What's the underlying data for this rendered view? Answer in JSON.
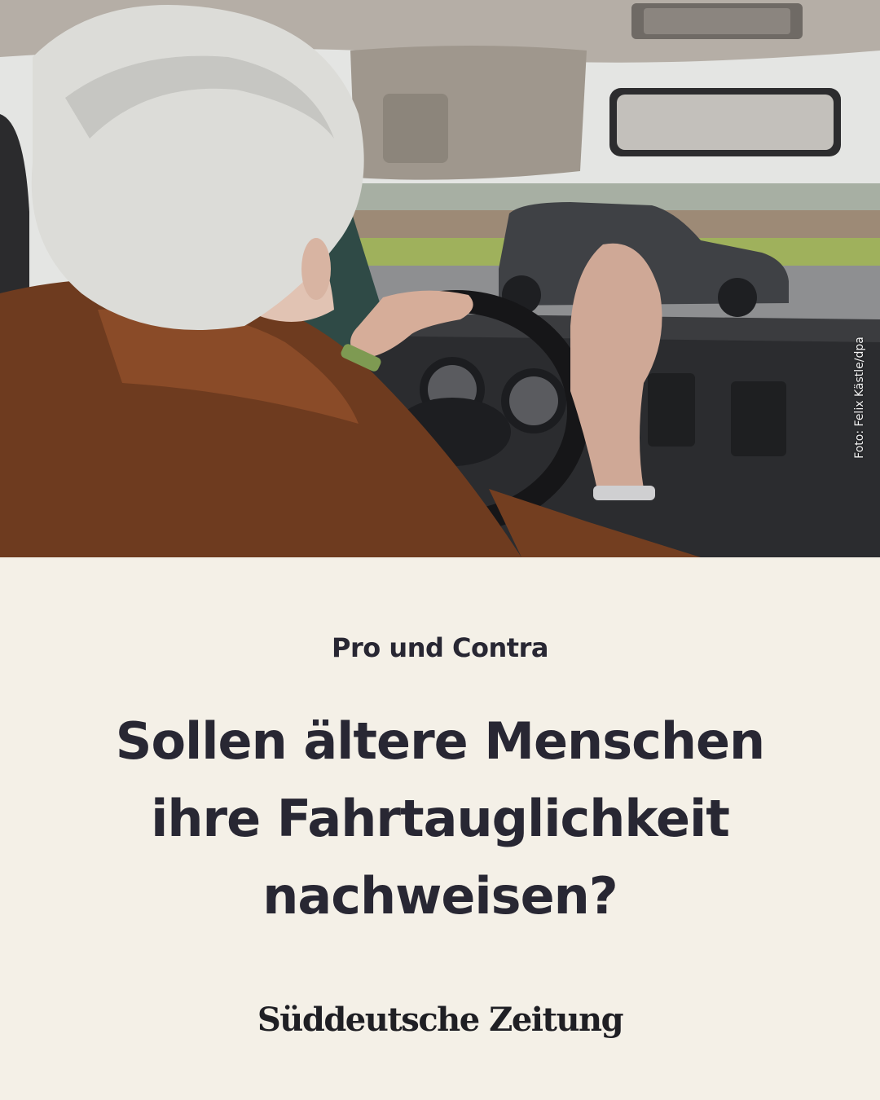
{
  "photo": {
    "credit": "Foto: Felix Kästle/dpa"
  },
  "kicker": "Pro und Contra",
  "headline": {
    "line1": "Sollen ältere Menschen",
    "line2": "ihre Fahrtauglichkeit",
    "line3": "nachweisen?"
  },
  "brand": {
    "logo_text": "Süddeutsche Zeitung"
  },
  "colors": {
    "background": "#f4f0e7",
    "text": "#282733"
  }
}
